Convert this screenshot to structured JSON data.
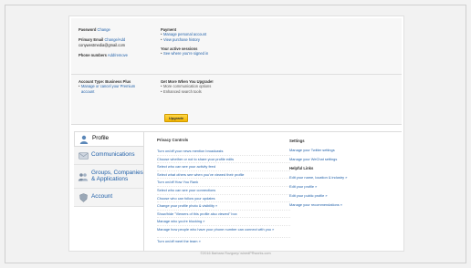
{
  "account": {
    "password_label": "Password",
    "password_change": "Change",
    "email_label": "Primary Email",
    "email_change": "Change/Add",
    "email_value": "conywestmedia@gmail.com",
    "phone_label": "Phone numbers",
    "phone_add": "Add/remove",
    "payment_label": "Payment",
    "payment_links": [
      "Manage personal account",
      "View purchase history"
    ],
    "sessions_label": "Your active sessions",
    "sessions_link": "See where you're signed in",
    "type_label": "Account Type: Business Plus",
    "type_links": [
      "Manage or cancel your Premium",
      "account"
    ],
    "upgrade_label": "Get More When You Upgrade!",
    "upgrade_bullets": [
      "More communication options",
      "Enhanced search tools"
    ],
    "upgrade_button": "Upgrade"
  },
  "nav": {
    "items": [
      {
        "label": "Profile",
        "icon": "person-icon"
      },
      {
        "label": "Communications",
        "icon": "envelope-icon"
      },
      {
        "label": "Groups, Companies & Applications",
        "icon": "groups-icon"
      },
      {
        "label": "Account",
        "icon": "shield-icon"
      }
    ]
  },
  "privacy": {
    "title": "Privacy Controls",
    "items": [
      "Turn on/off your news mention broadcasts",
      "Choose whether or not to share your profile edits",
      "Select who can see your activity feed",
      "Select what others see when you've viewed their profile",
      "Turn on/off How You Rank",
      "Select who can see your connections",
      "Choose who can follow your updates",
      "Change your profile photo & visibility »",
      "Show/hide \"Viewers of this profile also viewed\" box",
      "Manage who you're blocking »",
      "Manage how people who have your phone number can connect with you »",
      "Turn on/off meet the team »"
    ]
  },
  "settings": {
    "title": "Settings",
    "items": [
      "Manage your Twitter settings",
      "Manage your WeChat settings"
    ],
    "helpful_title": "Helpful Links",
    "helpful": [
      "Edit your name, location & industry »",
      "Edit your profile »",
      "Edit your public profile »",
      "Manage your recommendations »"
    ]
  },
  "footer": "©2016 Barbara Rozgony/ winedPRworks.com",
  "colors": {
    "link": "#1f5fa8",
    "upgrade": "#f2b500"
  }
}
